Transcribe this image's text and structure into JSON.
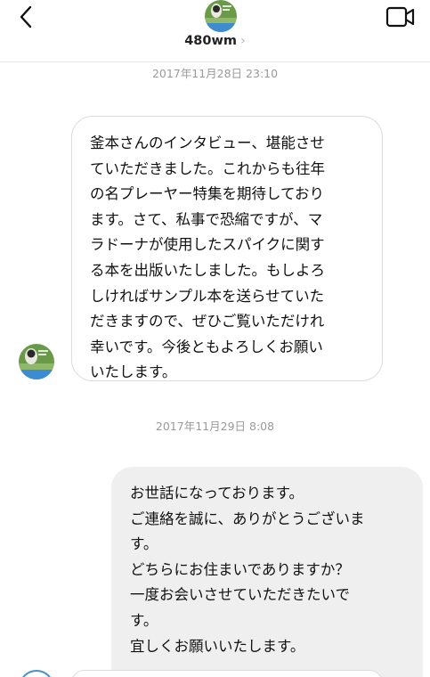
{
  "header": {
    "username": "480wm",
    "chevron": "›",
    "back_icon": "chevron-left-icon",
    "video_icon": "video-camera-icon"
  },
  "conversation": {
    "timestamp_1": "2017年11月28日 23:10",
    "incoming_message_lines": [
      "釜本さんのインタビュー、堪能させ",
      "ていただきました。これからも往年",
      "の名プレーヤー特集を期待しており",
      "ます。さて、私事で恐縮ですが、マ",
      "ラドーナが使用したスパイクに関す",
      "る本を出版いたしました。もしよろ",
      "しければサンプル本を送らせていた",
      "だきますので、ぜひご覧いただけれ",
      "幸いです。今後ともよろしくお願い",
      "いたします。"
    ],
    "timestamp_2": "2017年11月29日 8:08",
    "outgoing_message_lines": [
      "お世話になっております。",
      "ご連絡を誠に、ありがとうございま",
      "す。",
      "どちらにお住まいでありますか？",
      "一度お会いさせていただきたいで",
      "す。",
      "宜しくお願いいたします。"
    ]
  },
  "colors": {
    "incoming_bubble_border": "#dcdcdc",
    "outgoing_bubble_bg": "#efefef",
    "timestamp_text": "#9a9a9a",
    "avatar_green": "#5a8f3a",
    "avatar_blue": "#3d8bd0"
  }
}
